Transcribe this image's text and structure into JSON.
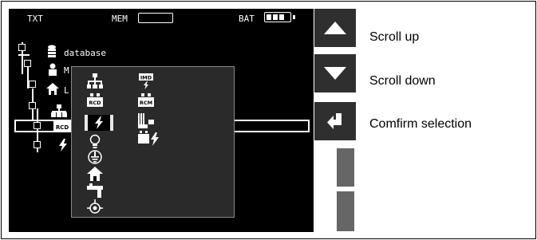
{
  "status": {
    "txt_label": "TXT",
    "mem_label": "MEM",
    "bat_label": "BAT",
    "battery_cells_filled": 3
  },
  "tree": {
    "database_label": "database",
    "user_label_partial": "M",
    "house_label_partial": "L"
  },
  "popup": {
    "left_column_icons": [
      "distribution-icon",
      "rcd-icon",
      "power-lightning-icon",
      "bulb-icon",
      "earth-icon",
      "house-icon",
      "tap-icon",
      "probe-icon"
    ],
    "right_column_icons": [
      "imd-icon",
      "rcm-icon",
      "machine-icon",
      "power-lightning-icon"
    ],
    "selected_icon": "power-lightning-icon",
    "badges": {
      "rcd": "RCD",
      "imd": "IMD",
      "rcm": "RCM"
    }
  },
  "buttons": {
    "scroll_up": "Scroll up",
    "scroll_down": "Scroll down",
    "confirm": "Comfirm selection"
  },
  "colors": {
    "screen_bg": "#000000",
    "button_bg": "#2f2f2f",
    "popup_bg": "#2a2a2a",
    "selection_bg": "#e8e8e8"
  }
}
